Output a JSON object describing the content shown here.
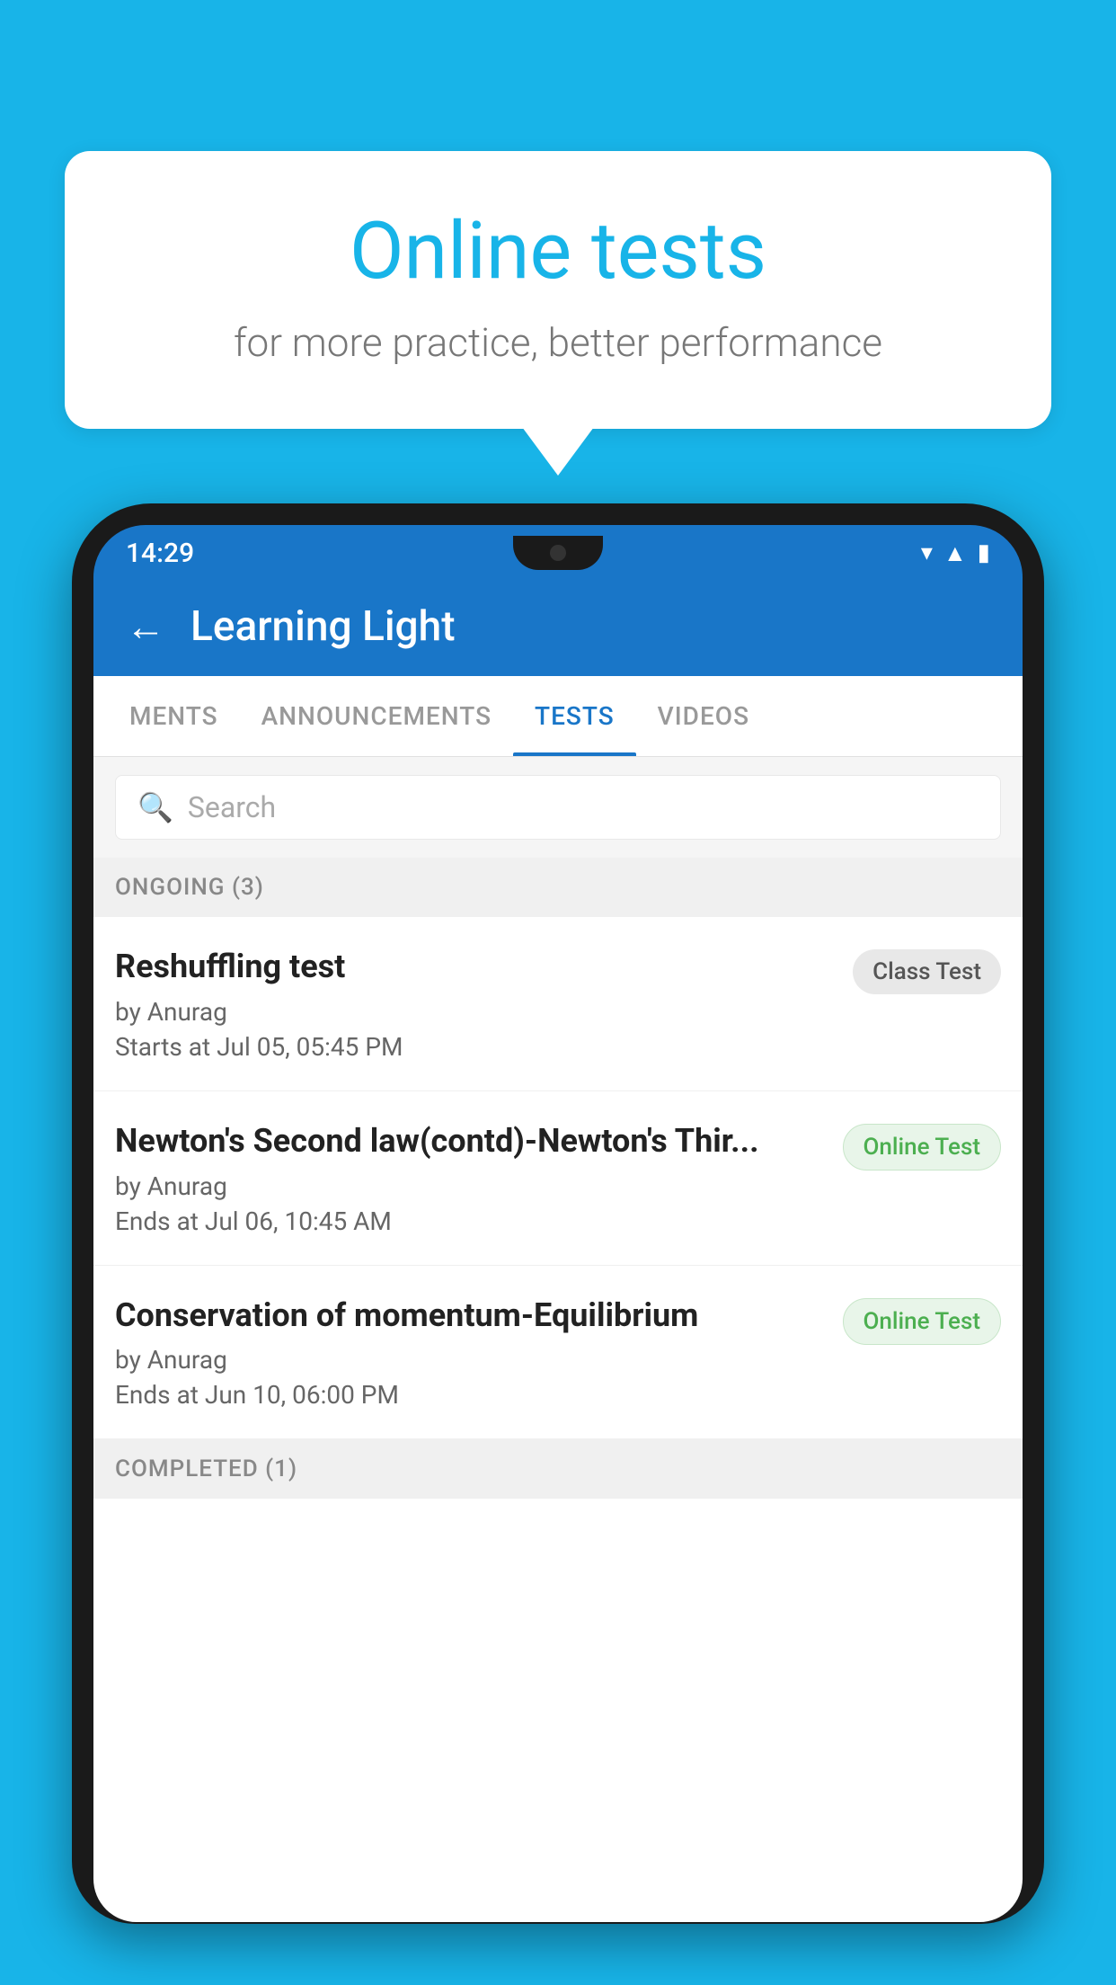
{
  "background_color": "#18b4e8",
  "bubble": {
    "title": "Online tests",
    "subtitle": "for more practice, better performance"
  },
  "phone": {
    "time": "14:29",
    "status_icons": [
      "wifi",
      "signal",
      "battery"
    ]
  },
  "app": {
    "header_title": "Learning Light",
    "back_label": "←"
  },
  "tabs": [
    {
      "label": "MENTS",
      "active": false
    },
    {
      "label": "ANNOUNCEMENTS",
      "active": false
    },
    {
      "label": "TESTS",
      "active": true
    },
    {
      "label": "VIDEOS",
      "active": false
    }
  ],
  "search": {
    "placeholder": "Search"
  },
  "ongoing_section": {
    "label": "ONGOING (3)"
  },
  "tests": [
    {
      "title": "Reshuffling test",
      "author": "by Anurag",
      "date": "Starts at  Jul 05, 05:45 PM",
      "badge": "Class Test",
      "badge_type": "class"
    },
    {
      "title": "Newton's Second law(contd)-Newton's Thir...",
      "author": "by Anurag",
      "date": "Ends at  Jul 06, 10:45 AM",
      "badge": "Online Test",
      "badge_type": "online"
    },
    {
      "title": "Conservation of momentum-Equilibrium",
      "author": "by Anurag",
      "date": "Ends at  Jun 10, 06:00 PM",
      "badge": "Online Test",
      "badge_type": "online"
    }
  ],
  "completed_section": {
    "label": "COMPLETED (1)"
  }
}
